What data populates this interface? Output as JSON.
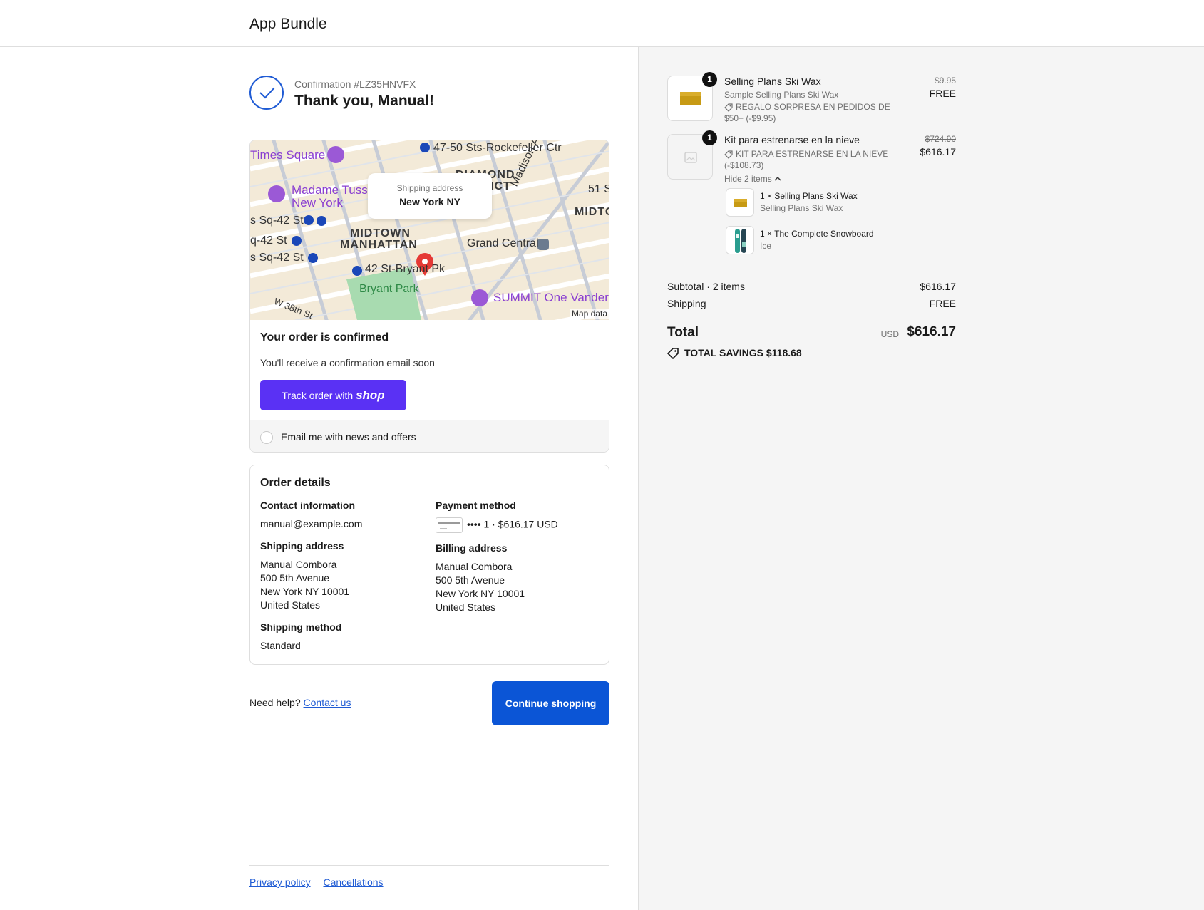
{
  "header": {
    "store_name": "App Bundle"
  },
  "confirmation": {
    "number": "Confirmation #LZ35HNVFX",
    "thank_you": "Thank you, Manual!"
  },
  "map": {
    "popup_title": "Shipping address",
    "popup_value": "New York NY",
    "attribution": "Map data",
    "labels": {
      "times_square": "Times Square",
      "rockefeller": "47-50 Sts-Rockefeller Ctr",
      "diamond": "DIAMOND",
      "district": "ICT",
      "madame": "Madame Tuss",
      "new_york": "New York",
      "madison": "Madison Ave",
      "st51": "51 S",
      "midtown_right": "MIDTO",
      "sq42_a": "s Sq-42 St",
      "sq42_b": "q-42 St",
      "sq42_c": "s Sq-42 St",
      "midtown": "MIDTOWN",
      "manhattan": "MANHATTAN",
      "grand_central": "Grand Central",
      "bryant_station": "42 St-Bryant Pk",
      "bryant_park": "Bryant Park",
      "summit": "SUMMIT One Vander",
      "w38": "W 38th St"
    }
  },
  "status": {
    "title": "Your order is confirmed",
    "subtitle": "You'll receive a confirmation email soon",
    "track_prefix": "Track order with",
    "track_brand": "shop",
    "email_opt_in": "Email me with news and offers"
  },
  "order_details": {
    "title": "Order details",
    "contact_heading": "Contact information",
    "contact_email": "manual@example.com",
    "shipping_address_heading": "Shipping address",
    "shipping_address": [
      "Manual Combora",
      "500 5th Avenue",
      "New York NY 10001",
      "United States"
    ],
    "shipping_method_heading": "Shipping method",
    "shipping_method": "Standard",
    "payment_heading": "Payment method",
    "payment_value": "•••• 1 · $616.17 USD",
    "billing_heading": "Billing address",
    "billing_address": [
      "Manual Combora",
      "500 5th Avenue",
      "New York NY 10001",
      "United States"
    ]
  },
  "help": {
    "prefix": "Need help?",
    "link": "Contact us",
    "continue_label": "Continue shopping"
  },
  "footer": {
    "privacy": "Privacy policy",
    "cancellations": "Cancellations"
  },
  "summary": {
    "items": [
      {
        "qty": "1",
        "name": "Selling Plans Ski Wax",
        "subtitle": "Sample Selling Plans Ski Wax",
        "discount": "REGALO SORPRESA EN PEDIDOS DE $50+ (-$9.95)",
        "price_old": "$9.95",
        "price_new": "FREE"
      },
      {
        "qty": "1",
        "name": "Kit para estrenarse en la nieve",
        "discount": "KIT PARA ESTRENARSE EN LA NIEVE (-$108.73)",
        "price_old": "$724.90",
        "price_new": "$616.17",
        "toggle": "Hide 2 items",
        "components": [
          {
            "name": "1 × Selling Plans Ski Wax",
            "variant": "Selling Plans Ski Wax"
          },
          {
            "name": "1 × The Complete Snowboard",
            "variant": "Ice"
          }
        ]
      }
    ],
    "subtotal_label": "Subtotal · 2 items",
    "subtotal_value": "$616.17",
    "shipping_label": "Shipping",
    "shipping_value": "FREE",
    "total_label": "Total",
    "currency": "USD",
    "total_value": "$616.17",
    "savings": "TOTAL SAVINGS  $118.68"
  },
  "colors": {
    "accent": "#0b55d6",
    "shop_purple": "#5a31f4",
    "summary_bg": "#f5f5f5"
  }
}
